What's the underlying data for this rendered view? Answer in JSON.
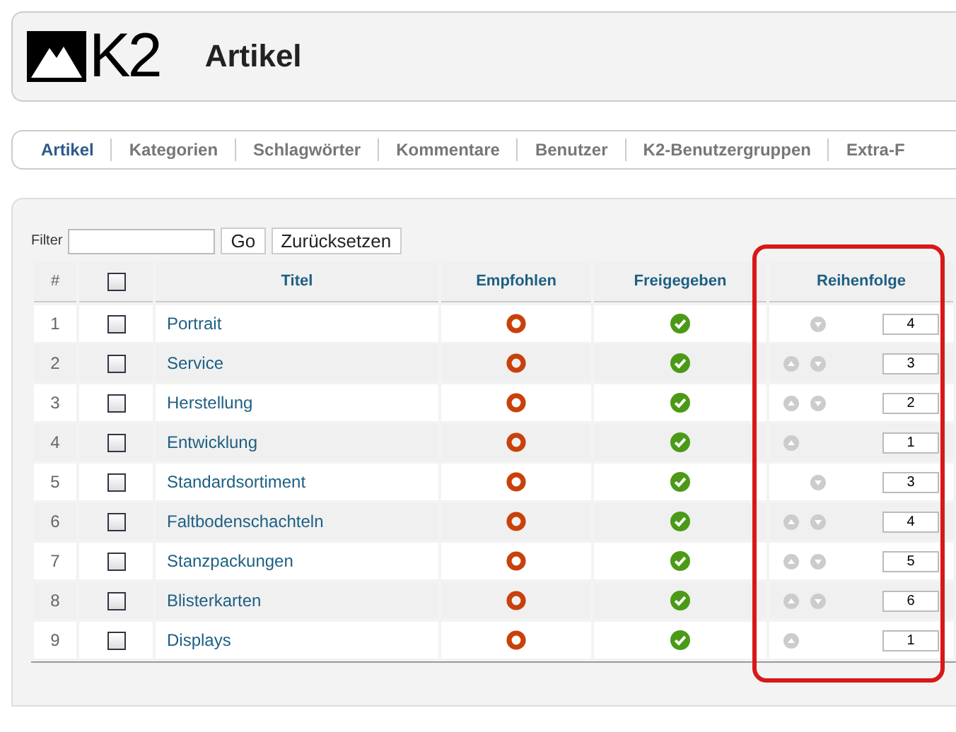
{
  "header": {
    "logo": "K2",
    "title": "Artikel"
  },
  "tabs": [
    {
      "label": "Artikel",
      "selected": true
    },
    {
      "label": "Kategorien",
      "selected": false
    },
    {
      "label": "Schlagwörter",
      "selected": false
    },
    {
      "label": "Kommentare",
      "selected": false
    },
    {
      "label": "Benutzer",
      "selected": false
    },
    {
      "label": "K2-Benutzergruppen",
      "selected": false
    },
    {
      "label": "Extra-F",
      "selected": false
    }
  ],
  "filter": {
    "label": "Filter",
    "go": "Go",
    "reset": "Zurücksetzen"
  },
  "table": {
    "columns": [
      "#",
      "Titel",
      "Empfohlen",
      "Freigegeben",
      "Reihenfolge"
    ],
    "header_checked": false,
    "ordering_highlighted": true,
    "rows": [
      {
        "num": "1",
        "checked": false,
        "title": "Portrait",
        "featured": false,
        "published": true,
        "can_move_up": false,
        "can_move_down": true,
        "order": "4"
      },
      {
        "num": "2",
        "checked": false,
        "title": "Service",
        "featured": false,
        "published": true,
        "can_move_up": true,
        "can_move_down": true,
        "order": "3"
      },
      {
        "num": "3",
        "checked": false,
        "title": "Herstellung",
        "featured": false,
        "published": true,
        "can_move_up": true,
        "can_move_down": true,
        "order": "2"
      },
      {
        "num": "4",
        "checked": false,
        "title": "Entwicklung",
        "featured": false,
        "published": true,
        "can_move_up": true,
        "can_move_down": false,
        "order": "1"
      },
      {
        "num": "5",
        "checked": false,
        "title": "Standardsortiment",
        "featured": false,
        "published": true,
        "can_move_up": false,
        "can_move_down": true,
        "order": "3"
      },
      {
        "num": "6",
        "checked": false,
        "title": "Faltbodenschachteln",
        "featured": false,
        "published": true,
        "can_move_up": true,
        "can_move_down": true,
        "order": "4"
      },
      {
        "num": "7",
        "checked": false,
        "title": "Stanzpackungen",
        "featured": false,
        "published": true,
        "can_move_up": true,
        "can_move_down": true,
        "order": "5"
      },
      {
        "num": "8",
        "checked": false,
        "title": "Blisterkarten",
        "featured": false,
        "published": true,
        "can_move_up": true,
        "can_move_down": true,
        "order": "6"
      },
      {
        "num": "9",
        "checked": false,
        "title": "Displays",
        "featured": false,
        "published": true,
        "can_move_up": true,
        "can_move_down": false,
        "order": "1"
      }
    ]
  }
}
